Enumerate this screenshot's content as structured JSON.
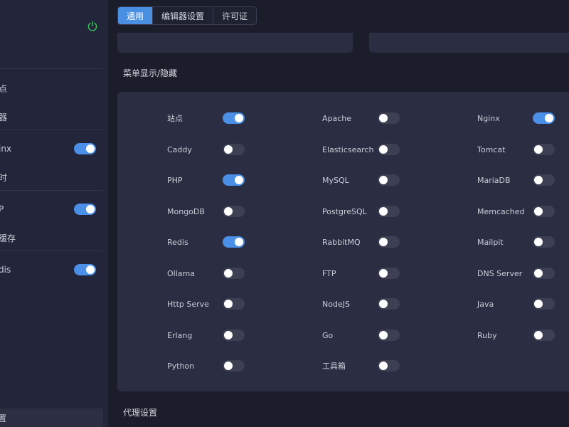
{
  "tabs": [
    {
      "label": "通用",
      "active": true
    },
    {
      "label": "编辑器设置",
      "active": false
    },
    {
      "label": "许可证",
      "active": false
    }
  ],
  "sidebar": {
    "power_icon": "power-icon",
    "items": [
      {
        "label": "点",
        "toggle": null
      },
      {
        "label": "器",
        "toggle": null
      },
      {
        "label": "inx",
        "toggle": true
      },
      {
        "label": "时",
        "toggle": null
      },
      {
        "label": "P",
        "toggle": true
      },
      {
        "label": "缓存",
        "toggle": null
      },
      {
        "label": "dis",
        "toggle": true
      }
    ],
    "bottom_item": {
      "label": "置"
    }
  },
  "sections": {
    "menu_title": "菜单显示/隐藏",
    "proxy_title": "代理设置"
  },
  "menu_items": [
    {
      "label": "站点",
      "on": true
    },
    {
      "label": "Apache",
      "on": false
    },
    {
      "label": "Nginx",
      "on": true
    },
    {
      "label": "Caddy",
      "on": false
    },
    {
      "label": "Elasticsearch",
      "on": false
    },
    {
      "label": "Tomcat",
      "on": false
    },
    {
      "label": "PHP",
      "on": true
    },
    {
      "label": "MySQL",
      "on": false
    },
    {
      "label": "MariaDB",
      "on": false
    },
    {
      "label": "MongoDB",
      "on": false
    },
    {
      "label": "PostgreSQL",
      "on": false
    },
    {
      "label": "Memcached",
      "on": false
    },
    {
      "label": "Redis",
      "on": true
    },
    {
      "label": "RabbitMQ",
      "on": false
    },
    {
      "label": "Mailpit",
      "on": false
    },
    {
      "label": "Ollama",
      "on": false
    },
    {
      "label": "FTP",
      "on": false
    },
    {
      "label": "DNS Server",
      "on": false
    },
    {
      "label": "Http Serve",
      "on": false
    },
    {
      "label": "NodeJS",
      "on": false
    },
    {
      "label": "Java",
      "on": false
    },
    {
      "label": "Erlang",
      "on": false
    },
    {
      "label": "Go",
      "on": false
    },
    {
      "label": "Ruby",
      "on": false
    },
    {
      "label": "Python",
      "on": false
    },
    {
      "label": "工具箱",
      "on": false
    }
  ],
  "colors": {
    "accent": "#4a90e2",
    "toggle_on": "#4a8fe8",
    "toggle_off": "#3d4052",
    "panel": "#2b2e42",
    "background": "#1b1d2b",
    "power_icon": "#3cc45a"
  }
}
